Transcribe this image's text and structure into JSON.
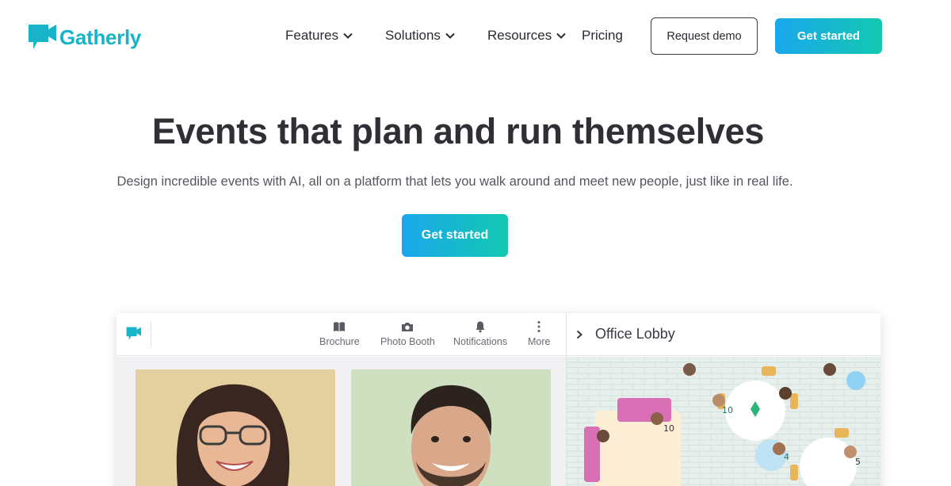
{
  "brand": {
    "name": "Gatherly",
    "color": "#16b3c9"
  },
  "nav": {
    "items": [
      {
        "label": "Features",
        "has_dropdown": true
      },
      {
        "label": "Solutions",
        "has_dropdown": true
      },
      {
        "label": "Resources",
        "has_dropdown": true
      },
      {
        "label": "Pricing",
        "has_dropdown": false
      }
    ],
    "request_demo_label": "Request demo",
    "get_started_label": "Get started"
  },
  "hero": {
    "title": "Events that plan and run themselves",
    "subtitle": "Design incredible events with AI, all on a platform that lets you walk around and meet new people, just like in real life.",
    "cta_label": "Get started"
  },
  "mock": {
    "toolbar": [
      {
        "label": "Brochure",
        "icon": "book-icon"
      },
      {
        "label": "Photo Booth",
        "icon": "camera-icon"
      },
      {
        "label": "Notifications",
        "icon": "bell-icon"
      },
      {
        "label": "More",
        "icon": "more-vertical-icon"
      }
    ],
    "room": {
      "title": "Office Lobby"
    },
    "map_badges": [
      "10",
      "10",
      "4",
      "5"
    ]
  },
  "colors": {
    "gradient_start": "#1aa7ec",
    "gradient_end": "#13c9b0"
  }
}
